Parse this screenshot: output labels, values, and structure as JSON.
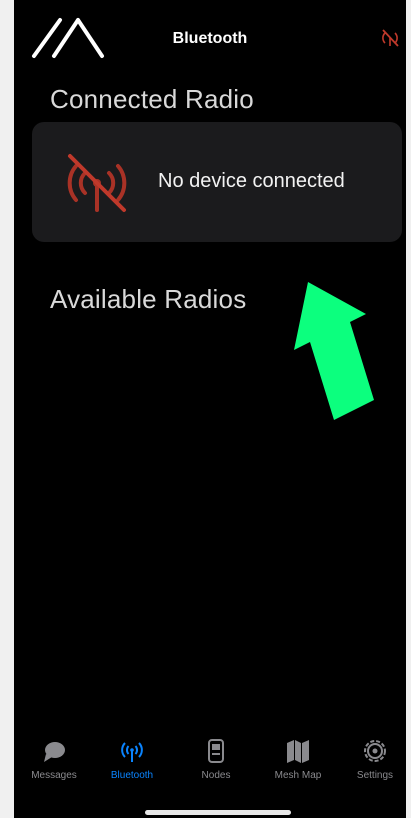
{
  "header": {
    "title": "Bluetooth",
    "logo_icon": "meshtastic-logo-icon",
    "status_icon": "radio-disconnected-icon"
  },
  "connected_section": {
    "title": "Connected Radio"
  },
  "connected_card": {
    "icon": "radio-disconnected-icon",
    "text": "No device connected",
    "icon_color": "#c0392b"
  },
  "available_section": {
    "title": "Available Radios"
  },
  "annotation": {
    "icon": "green-arrow-icon",
    "color": "#0cff7e"
  },
  "tabbar": {
    "items": [
      {
        "label": "Messages",
        "icon": "message-bubble-icon",
        "active": false
      },
      {
        "label": "Bluetooth",
        "icon": "bluetooth-antenna-icon",
        "active": true
      },
      {
        "label": "Nodes",
        "icon": "node-device-icon",
        "active": false
      },
      {
        "label": "Mesh Map",
        "icon": "map-icon",
        "active": false
      },
      {
        "label": "Settings",
        "icon": "gear-icon",
        "active": false
      }
    ],
    "active_color": "#0a84ff",
    "inactive_color": "#8a8a8e"
  }
}
